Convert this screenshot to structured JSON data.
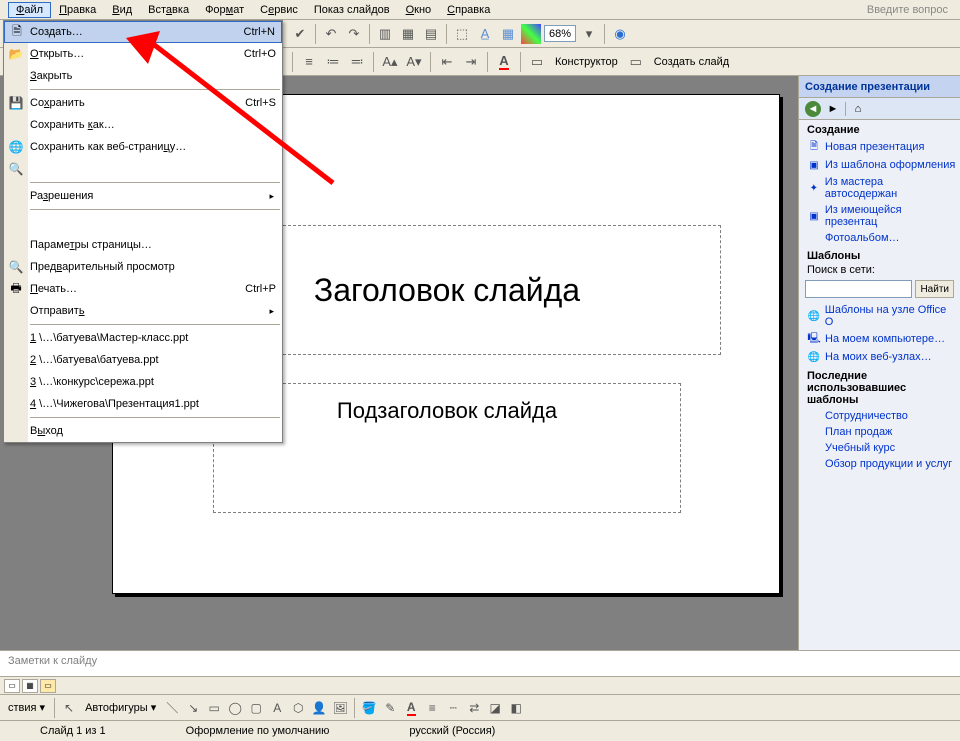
{
  "menubar": {
    "items": [
      "Файл",
      "Правка",
      "Вид",
      "Вставка",
      "Формат",
      "Сервис",
      "Показ слайдов",
      "Окно",
      "Справка"
    ],
    "help_placeholder": "Введите вопрос"
  },
  "toolbar": {
    "zoom": "68%",
    "designer": "Конструктор",
    "new_slide": "Создать слайд"
  },
  "file_menu": {
    "items": [
      {
        "icon": "doc",
        "label": "Создать…",
        "shortcut": "Ctrl+N",
        "hl": true
      },
      {
        "icon": "open",
        "label": "Открыть…",
        "shortcut": "Ctrl+O"
      },
      {
        "icon": "",
        "label": "Закрыть",
        "shortcut": ""
      },
      {
        "sep": true
      },
      {
        "icon": "save",
        "label": "Сохранить",
        "shortcut": "Ctrl+S"
      },
      {
        "icon": "",
        "label": "Сохранить как…",
        "shortcut": ""
      },
      {
        "icon": "web",
        "label": "Сохранить как веб-страницу…",
        "shortcut": ""
      },
      {
        "icon": "search",
        "label": "⁠",
        "shortcut": ""
      },
      {
        "sep": true
      },
      {
        "icon": "",
        "label": "Разрешения",
        "shortcut": "",
        "arrow": true
      },
      {
        "sep": true
      },
      {
        "icon": "",
        "label": "⁠",
        "shortcut": ""
      },
      {
        "icon": "",
        "label": "Параметры страницы…",
        "shortcut": ""
      },
      {
        "icon": "preview",
        "label": "Предварительный просмотр",
        "shortcut": ""
      },
      {
        "icon": "print",
        "label": "Печать…",
        "shortcut": "Ctrl+P"
      },
      {
        "icon": "",
        "label": "Отправить",
        "shortcut": "",
        "arrow": true
      },
      {
        "sep": true
      },
      {
        "icon": "",
        "label": "1 \\…\\батуева\\Мастер-класс.ppt",
        "shortcut": ""
      },
      {
        "icon": "",
        "label": "2 \\…\\батуева\\батуева.ppt",
        "shortcut": ""
      },
      {
        "icon": "",
        "label": "3 \\…\\конкурс\\сережа.ppt",
        "shortcut": ""
      },
      {
        "icon": "",
        "label": "4 \\…\\Чижегова\\Презентация1.ppt",
        "shortcut": ""
      },
      {
        "sep": true
      },
      {
        "icon": "",
        "label": "Выход",
        "shortcut": ""
      }
    ]
  },
  "slide": {
    "title_placeholder": "Заголовок слайда",
    "subtitle_placeholder": "Подзаголовок слайда"
  },
  "taskpane": {
    "title": "Создание презентации",
    "section_create": "Создание",
    "links_create": [
      "Новая презентация",
      "Из шаблона оформления",
      "Из мастера автосодержан",
      "Из имеющейся презентац",
      "Фотоальбом…"
    ],
    "section_templates": "Шаблоны",
    "search_label": "Поиск в сети:",
    "search_button": "Найти",
    "links_templates": [
      "Шаблоны на узле Office O",
      "На моем компьютере…",
      "На моих веб-узлах…"
    ],
    "section_recent": "Последние использовавшиес шаблоны",
    "links_recent": [
      "Сотрудничество",
      "План продаж",
      "Учебный курс",
      "Обзор продукции и услуг"
    ]
  },
  "notes": {
    "placeholder": "Заметки к слайду"
  },
  "drawbar": {
    "actions": "ствия ▾",
    "autoshapes": "Автофигуры ▾"
  },
  "statusbar": {
    "slide": "Слайд 1 из 1",
    "design": "Оформление по умолчанию",
    "lang": "русский (Россия)"
  }
}
